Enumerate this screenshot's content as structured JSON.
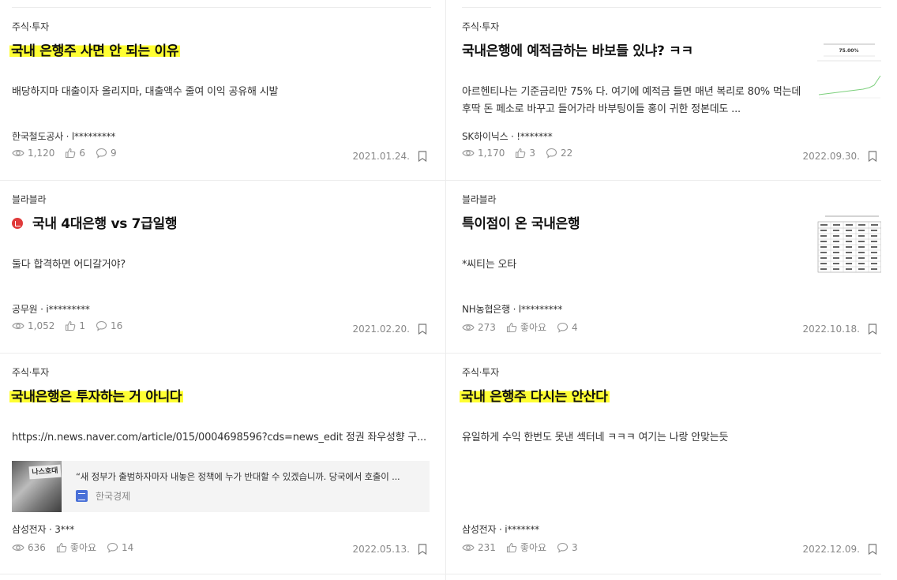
{
  "posts": [
    {
      "category": "주식·투자",
      "title": "국내 은행주 사면 안 되는 이유",
      "excerpt": "배당하지마 대출이자 올리지마, 대출액수 줄여 이익 공유해 시발",
      "author": "한국철도공사 · l*********",
      "views": "1,120",
      "likes": "6",
      "comments": "9",
      "date": "2021.01.24."
    },
    {
      "category": "주식·투자",
      "title": "국내은행에 예적금하는 바보들 있냐? ㅋㅋ",
      "excerpt": "아르헨티나는 기준금리만 75% 다. 여기에 예적금 들면 매년 복리로 80% 먹는데 후딱 돈 페소로 바꾸고 들어가라 바부팅이들 홍이 귀한 정본데도 ...",
      "author": "SK하이닉스 · !*******",
      "views": "1,170",
      "likes": "3",
      "comments": "22",
      "date": "2022.09.30.",
      "thumb_value": "75.00%"
    },
    {
      "category": "블라블라",
      "title": "국내 4대은행 vs 7급일행",
      "excerpt": "둘다 합격하면 어디갈거야?",
      "author": "공무원 · i*********",
      "views": "1,052",
      "likes": "1",
      "comments": "16",
      "date": "2021.02.20."
    },
    {
      "category": "블라블라",
      "title": "특이점이 온 국내은행",
      "excerpt": "*씨티는 오타",
      "author": "NH농협은행 · l*********",
      "views": "273",
      "likes": "좋아요",
      "comments": "4",
      "date": "2022.10.18."
    },
    {
      "category": "주식·투자",
      "title": "국내은행은 투자하는 거 아니다",
      "excerpt": "https://n.news.naver.com/article/015/0004698596?cds=news_edit 정권 좌우성향 구...",
      "link_title": "“새 정부가 출범하자마자 내놓은 정책에 누가 반대할 수 있겠습니까. 당국에서 호출이 ...",
      "link_source": "한국경제",
      "link_sign": "나스호대",
      "author": "삼성전자 · 3***",
      "views": "636",
      "likes": "좋아요",
      "comments": "14",
      "date": "2022.05.13."
    },
    {
      "category": "주식·투자",
      "title": "국내 은행주 다시는 안산다",
      "excerpt": "유일하게 수익 한번도 못낸 섹터네 ㅋㅋㅋ 여기는 나랑 안맞는듯",
      "author": "삼성전자 · i*******",
      "views": "231",
      "likes": "좋아요",
      "comments": "3",
      "date": "2022.12.09."
    }
  ]
}
